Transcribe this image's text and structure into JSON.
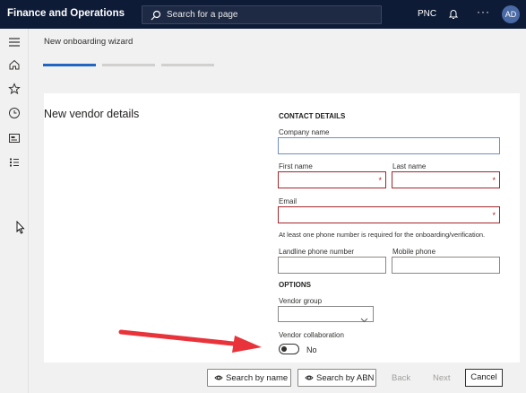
{
  "topbar": {
    "app_title": "Finance and Operations",
    "search_placeholder": "Search for a page",
    "company": "PNC",
    "more": "···",
    "avatar_initials": "AD"
  },
  "wizard": {
    "title": "New onboarding wizard",
    "steps": [
      {
        "state": "active",
        "color": "#2266c2"
      },
      {
        "state": "pending",
        "color": "#d2d0ce"
      },
      {
        "state": "pending",
        "color": "#d2d0ce"
      }
    ]
  },
  "form": {
    "title": "New vendor details",
    "contact_section": "CONTACT DETAILS",
    "company_name_label": "Company name",
    "company_name_value": "",
    "first_name_label": "First name",
    "first_name_value": "",
    "last_name_label": "Last name",
    "last_name_value": "",
    "email_label": "Email",
    "email_value": "",
    "required_marker": "*",
    "phone_info": "At least one phone number is required for the onboarding/verification.",
    "landline_label": "Landline phone number",
    "landline_value": "",
    "mobile_label": "Mobile phone",
    "mobile_value": "",
    "options_section": "OPTIONS",
    "vendor_group_label": "Vendor group",
    "vendor_group_value": "",
    "vendor_collab_label": "Vendor collaboration",
    "vendor_collab_state": "No"
  },
  "footer": {
    "search_by_name": "Search by name",
    "search_by_abn": "Search by ABN",
    "back": "Back",
    "next": "Next",
    "cancel": "Cancel"
  },
  "colors": {
    "topbar": "#0d1b36",
    "accent": "#2266c2",
    "required": "#a4262c",
    "annotation_arrow": "#e8333a"
  },
  "icons": [
    "search-icon",
    "bell-icon",
    "hamburger-icon",
    "home-icon",
    "star-icon",
    "clock-icon",
    "workspace-icon",
    "list-icon",
    "chevron-down-icon",
    "eye-icon",
    "red-arrow-annotation"
  ]
}
